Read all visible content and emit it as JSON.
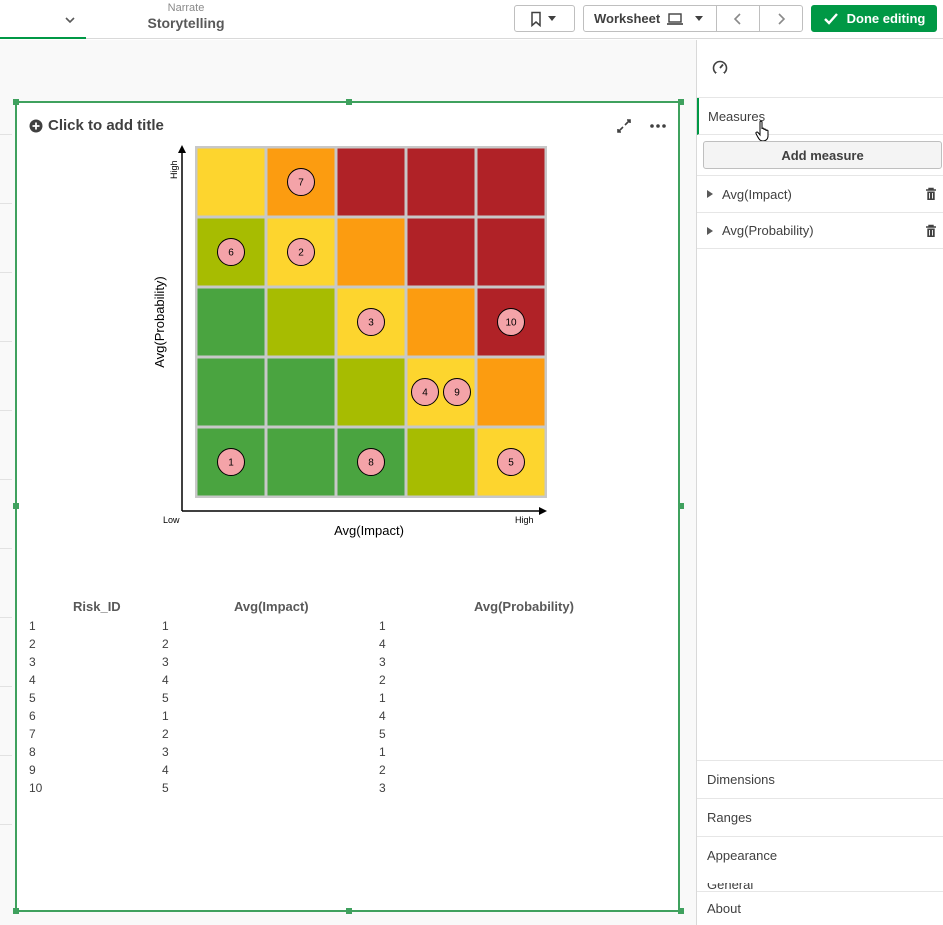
{
  "topbar": {
    "left_tab_stub": "",
    "narrate_category": "Narrate",
    "narrate_label": "Storytelling",
    "worksheet_label": "Worksheet",
    "done_label": "Done editing"
  },
  "viz": {
    "title_placeholder": "Click to add title"
  },
  "chart_data": {
    "type": "heatmap",
    "xlabel": "Avg(Impact)",
    "ylabel": "Avg(Probability)",
    "x_low": "Low",
    "x_high": "High",
    "y_high": "High",
    "x_range": [
      1,
      5
    ],
    "y_range": [
      1,
      5
    ],
    "grid_colors": [
      [
        "#fdd52e",
        "#fc9c10",
        "#b02227",
        "#b02227",
        "#b02227"
      ],
      [
        "#a7bc01",
        "#fdd52e",
        "#fc9c10",
        "#b02227",
        "#b02227"
      ],
      [
        "#4aa440",
        "#a7bc01",
        "#fdd52e",
        "#fc9c10",
        "#b02227"
      ],
      [
        "#4aa440",
        "#4aa440",
        "#a7bc01",
        "#fdd52e",
        "#fc9c10"
      ],
      [
        "#4aa440",
        "#4aa440",
        "#4aa440",
        "#a7bc01",
        "#fdd52e"
      ]
    ],
    "points": [
      {
        "id": "1",
        "impact": 1,
        "probability": 1
      },
      {
        "id": "2",
        "impact": 2,
        "probability": 4
      },
      {
        "id": "3",
        "impact": 3,
        "probability": 3
      },
      {
        "id": "4",
        "impact": 4,
        "probability": 2
      },
      {
        "id": "5",
        "impact": 5,
        "probability": 1
      },
      {
        "id": "6",
        "impact": 1,
        "probability": 4
      },
      {
        "id": "7",
        "impact": 2,
        "probability": 5
      },
      {
        "id": "8",
        "impact": 3,
        "probability": 1
      },
      {
        "id": "9",
        "impact": 4,
        "probability": 2
      },
      {
        "id": "10",
        "impact": 5,
        "probability": 3
      }
    ],
    "point_color": "#f4a3a8"
  },
  "table": {
    "headers": [
      "Risk_ID",
      "Avg(Impact)",
      "Avg(Probability)"
    ],
    "rows": [
      [
        "1",
        "1",
        "1"
      ],
      [
        "2",
        "2",
        "4"
      ],
      [
        "3",
        "3",
        "3"
      ],
      [
        "4",
        "4",
        "2"
      ],
      [
        "5",
        "5",
        "1"
      ],
      [
        "6",
        "1",
        "4"
      ],
      [
        "7",
        "2",
        "5"
      ],
      [
        "8",
        "3",
        "1"
      ],
      [
        "9",
        "4",
        "2"
      ],
      [
        "10",
        "5",
        "3"
      ]
    ]
  },
  "panel": {
    "measures_label": "Measures",
    "add_measure_label": "Add measure",
    "measures": [
      "Avg(Impact)",
      "Avg(Probability)"
    ],
    "sections": [
      "Dimensions",
      "Ranges",
      "Appearance"
    ],
    "general_stub": "General",
    "about_label": "About"
  },
  "colors": {
    "accent": "#009845",
    "selection_border": "#3fa15e"
  }
}
